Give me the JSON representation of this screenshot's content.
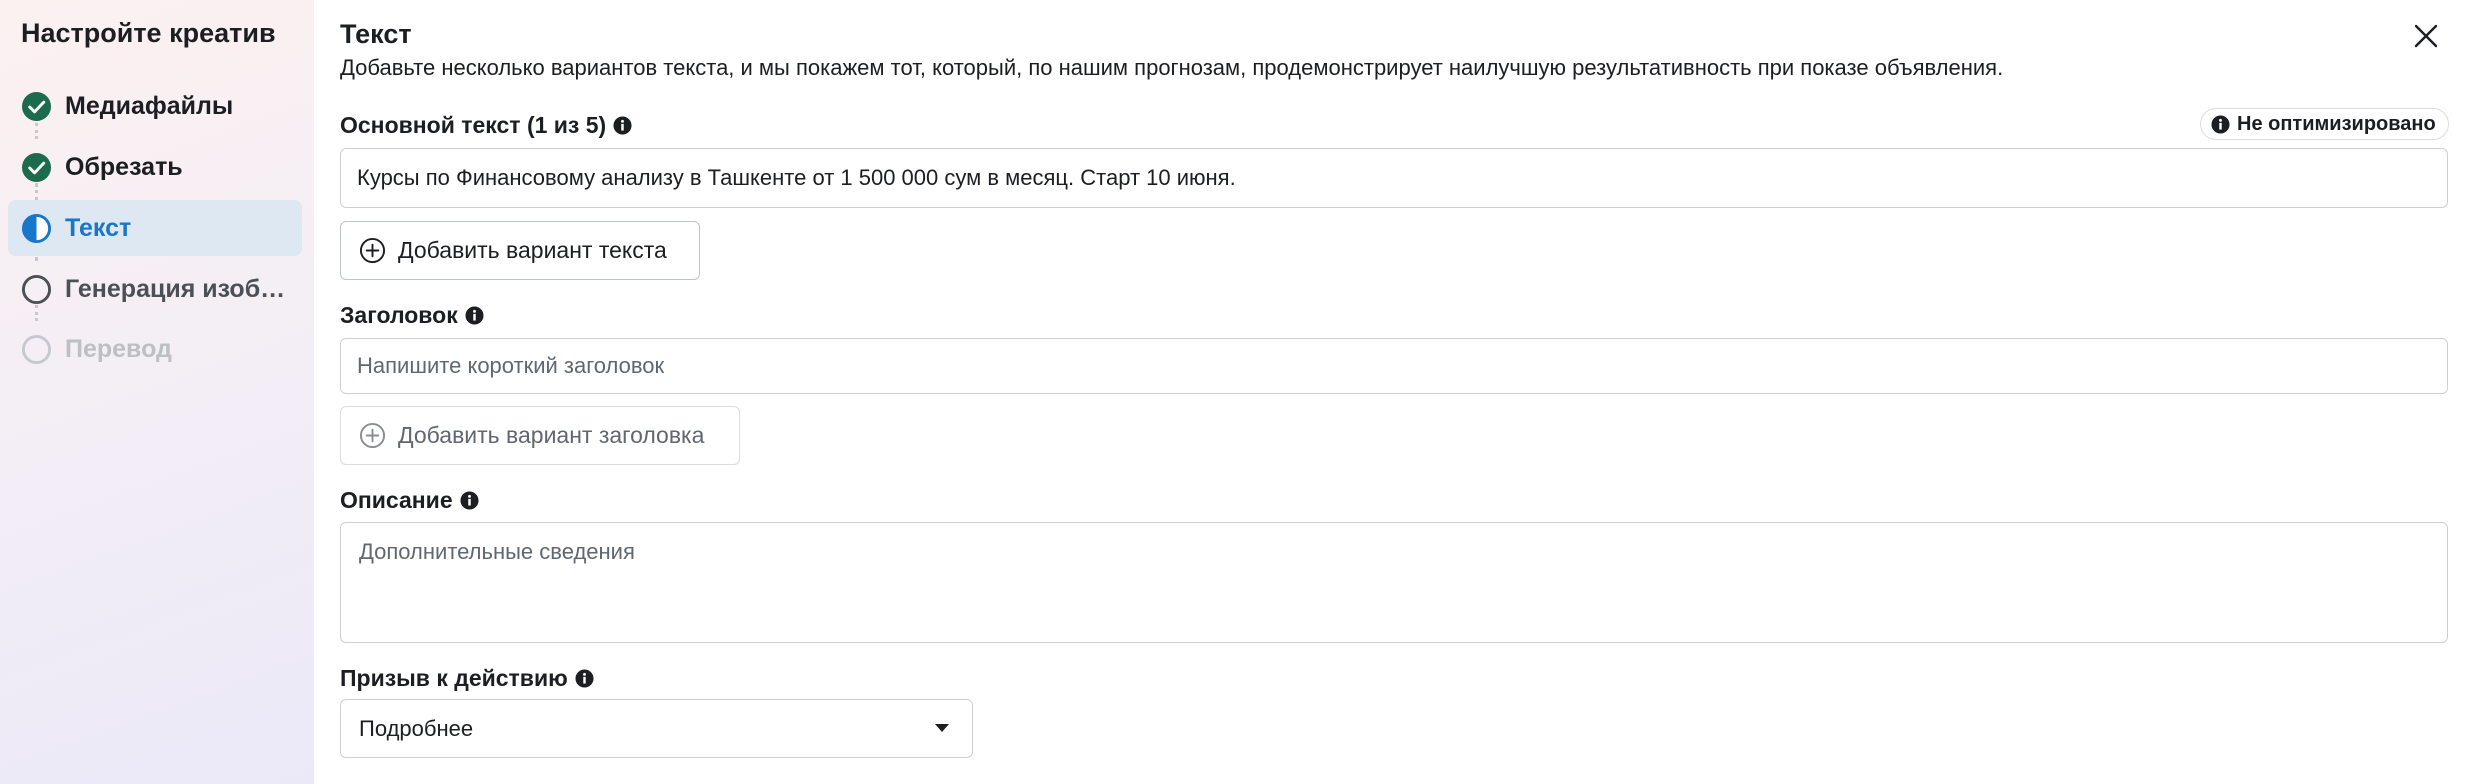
{
  "sidebar": {
    "title": "Настройте креатив",
    "steps": [
      {
        "label": "Медиафайлы",
        "state": "done",
        "icon": "check-circle-icon"
      },
      {
        "label": "Обрезать",
        "state": "done",
        "icon": "check-circle-icon"
      },
      {
        "label": "Текст",
        "state": "active",
        "icon": "half-circle-icon"
      },
      {
        "label": "Генерация изоб…",
        "state": "pending",
        "icon": "empty-circle-icon"
      },
      {
        "label": "Перевод",
        "state": "disabled",
        "icon": "empty-circle-icon"
      }
    ]
  },
  "main": {
    "title": "Текст",
    "description": "Добавьте несколько вариантов текста, и мы покажем тот, который, по нашим прогнозам, продемонстрирует наилучшую результативность при показе объявления.",
    "primary_text": {
      "label": "Основной текст (1 из 5)",
      "badge": "Не оптимизировано",
      "value": "Курсы по Финансовому анализу в Ташкенте от 1 500 000 сум в месяц. Старт 10 июня.",
      "add_button": "Добавить вариант текста"
    },
    "headline": {
      "label": "Заголовок",
      "placeholder": "Напишите короткий заголовок",
      "add_button": "Добавить вариант заголовка"
    },
    "description_field": {
      "label": "Описание",
      "placeholder": "Дополнительные сведения"
    },
    "cta": {
      "label": "Призыв к действию",
      "selected": "Подробнее"
    }
  },
  "colors": {
    "accent": "#1877c9",
    "check_green": "#1d6b4f",
    "active_bg": "#dde8f3"
  }
}
